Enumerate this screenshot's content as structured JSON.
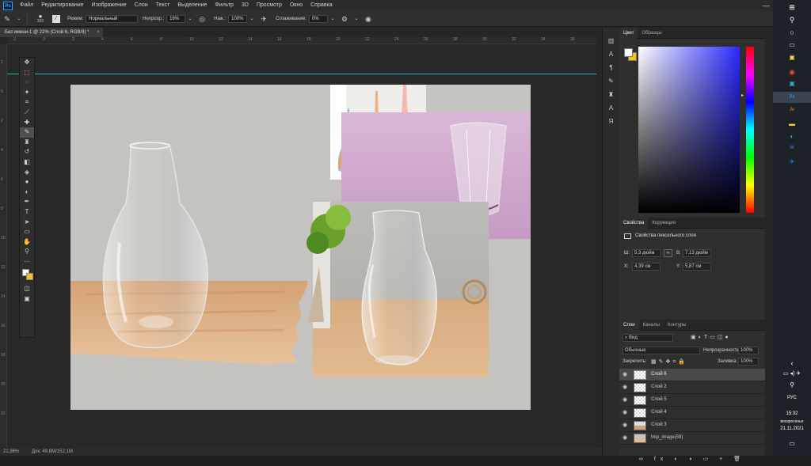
{
  "menu": {
    "logo": "Ps",
    "items": [
      "Файл",
      "Редактирование",
      "Изображение",
      "Слои",
      "Текст",
      "Выделение",
      "Фильтр",
      "3D",
      "Просмотр",
      "Окно",
      "Справка"
    ]
  },
  "options": {
    "brush_size": "300",
    "mode_label": "Режим:",
    "mode_value": "Нормальный",
    "opacity_label": "Непрозр.:",
    "opacity_value": "16%",
    "flow_label": "Наж.:",
    "flow_value": "100%",
    "smoothing_label": "Сглаживание:",
    "smoothing_value": "0%"
  },
  "document_tab": {
    "title": "Без имени-1 @ 22% (Слой 6, RGB/8) *",
    "close": "×"
  },
  "rulers": {
    "top": [
      "2",
      "0",
      "2",
      "4",
      "6",
      "8",
      "10",
      "12",
      "14",
      "16",
      "18",
      "20",
      "22",
      "24",
      "26",
      "28",
      "30",
      "32",
      "34",
      "36"
    ],
    "left": [
      "2",
      "0",
      "2",
      "4",
      "6",
      "8",
      "10",
      "12",
      "14",
      "16",
      "18",
      "20",
      "22"
    ]
  },
  "statusbar": {
    "zoom": "21,96%",
    "doc": "Док: 49,8М/152,1М"
  },
  "color_panel": {
    "tabs": [
      "Цвет",
      "Образцы"
    ],
    "fg": "#ffffff",
    "bg": "#f4c01a",
    "hue_marker": "#2222ff"
  },
  "properties": {
    "tabs": [
      "Свойства",
      "Коррекция"
    ],
    "header": "Свойства пиксельного слоя",
    "w_label": "Ш:",
    "w_value": "5,3 дюйм",
    "h_label": "В:",
    "h_value": "7,13 дюйм",
    "x_label": "X:",
    "x_value": "4,39 см",
    "y_label": "Y:",
    "y_value": "5,87 см"
  },
  "layers": {
    "tabs": [
      "Слои",
      "Каналы",
      "Контуры"
    ],
    "filter_value": "Вид",
    "blend_mode": "Обычные",
    "opacity_label": "Непрозрачность:",
    "opacity_value": "100%",
    "lock_label": "Закрепить:",
    "fill_label": "Заливка:",
    "fill_value": "100%",
    "items": [
      {
        "name": "Слой 6",
        "selected": true
      },
      {
        "name": "Слой 2",
        "selected": false
      },
      {
        "name": "Слой 5",
        "selected": false
      },
      {
        "name": "Слой 4",
        "selected": false
      },
      {
        "name": "Слой 3",
        "selected": false
      },
      {
        "name": "tmp_image(59)",
        "selected": false
      }
    ]
  },
  "taskbar": {
    "lang": "РУС",
    "time": "15:32",
    "day": "воскресенье",
    "date": "21.11.2021"
  }
}
